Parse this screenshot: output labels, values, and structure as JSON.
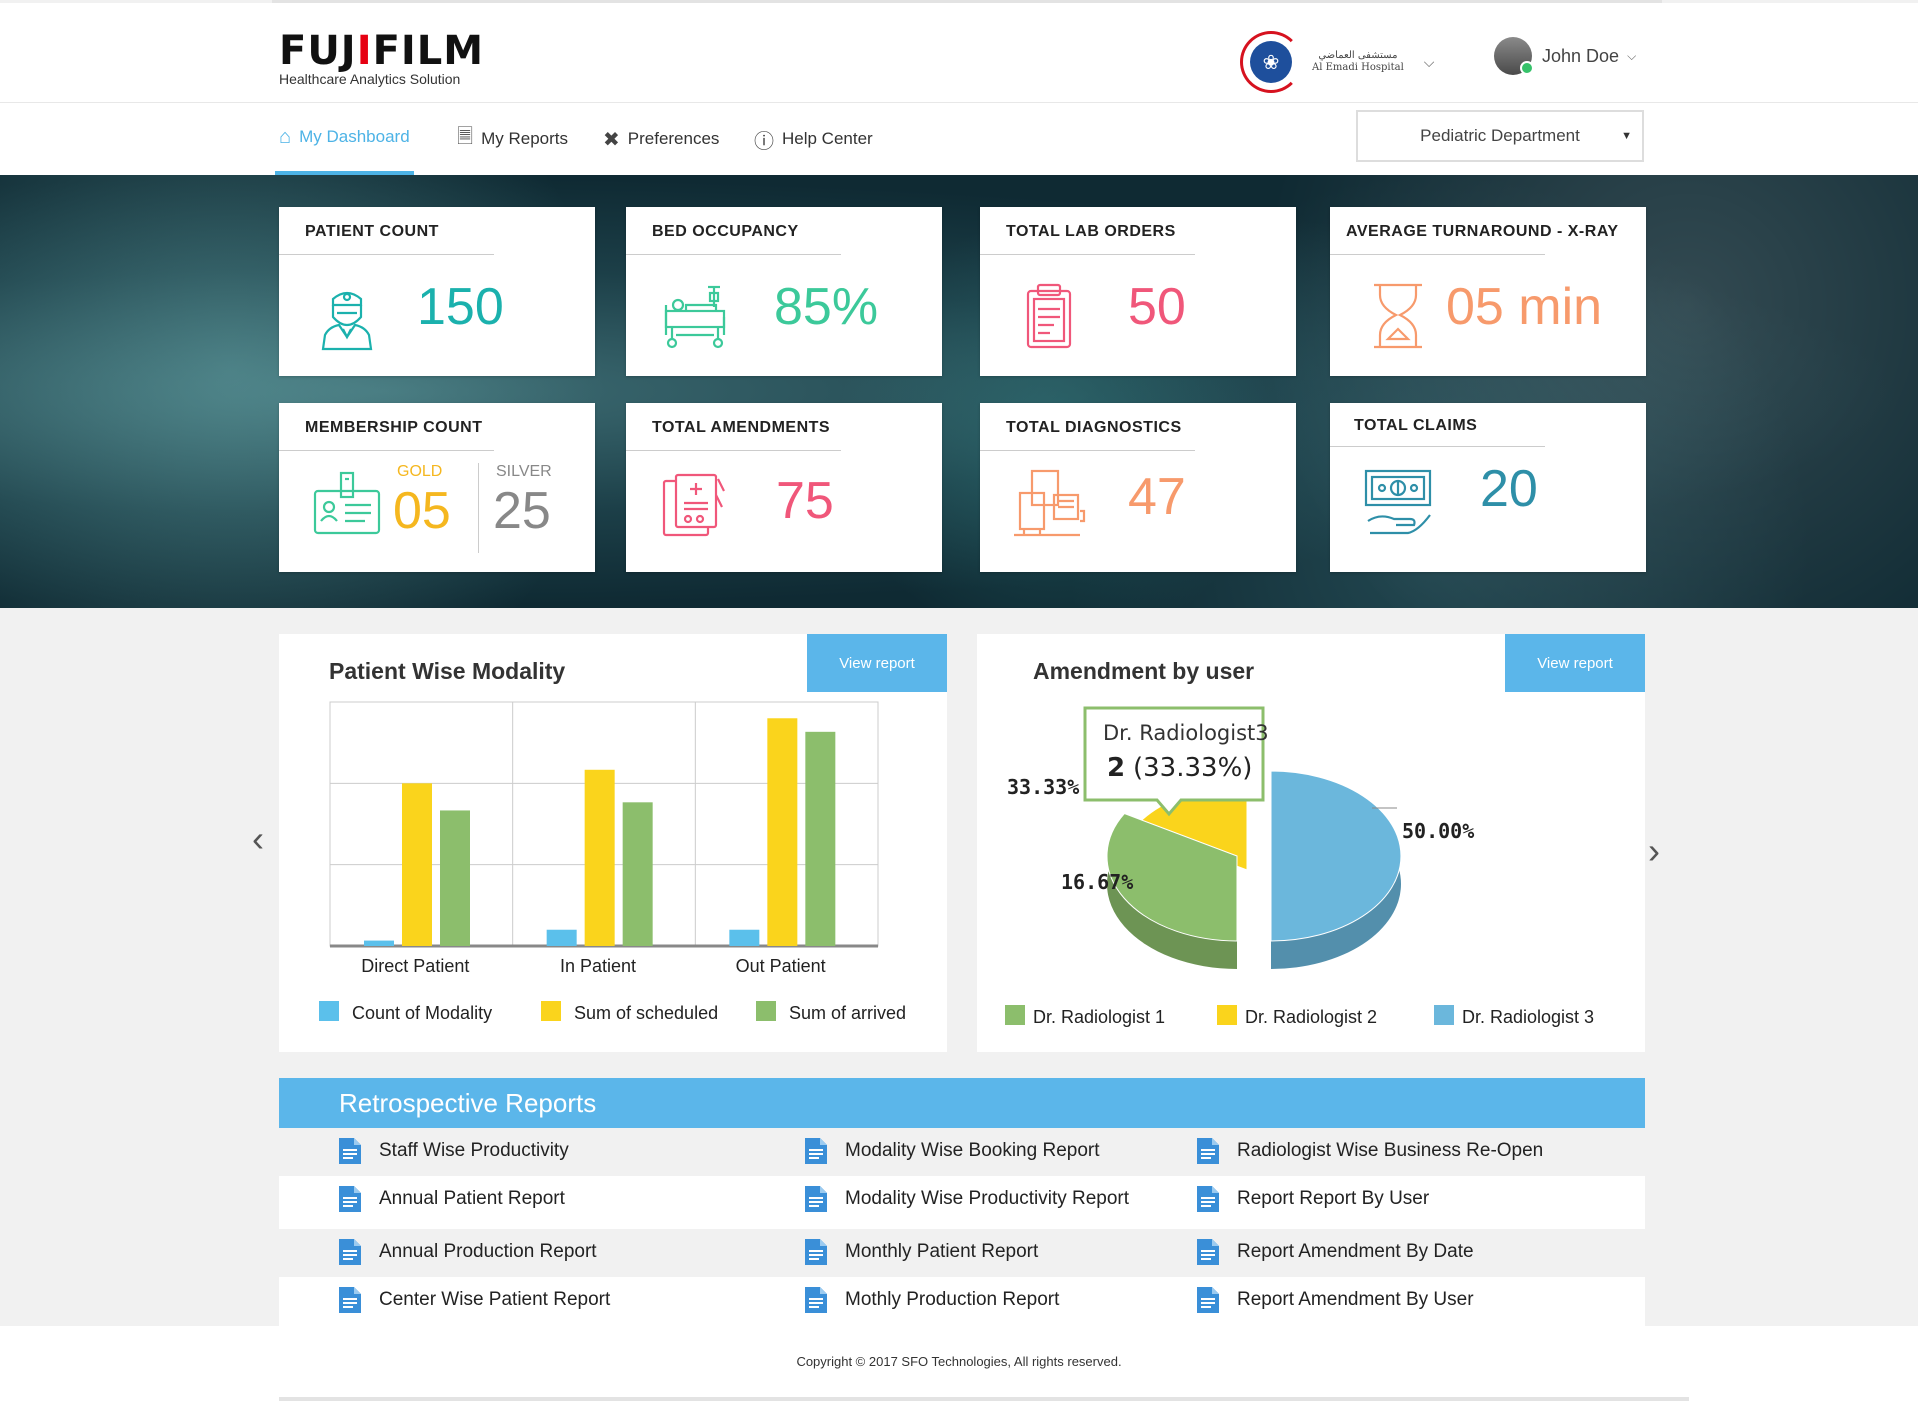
{
  "brand": {
    "name_part1": "FUJ",
    "name_i": "I",
    "name_part2": "FILM",
    "tagline": "Healthcare Analytics Solution"
  },
  "hospital": {
    "name_arabic": "مستشفى العماضي",
    "name_english": "Al Emadi Hospital"
  },
  "user": {
    "name": "John Doe"
  },
  "nav": {
    "items": [
      {
        "label": "My Dashboard",
        "icon": "home-icon",
        "active": true
      },
      {
        "label": "My Reports",
        "icon": "reports-icon",
        "active": false
      },
      {
        "label": "Preferences",
        "icon": "tools-icon",
        "active": false
      },
      {
        "label": "Help Center",
        "icon": "info-icon",
        "active": false
      }
    ],
    "department": "Pediatric Department"
  },
  "stats": {
    "patient_count": {
      "title": "PATIENT COUNT",
      "value": "150",
      "color": "#1bb1ad",
      "icon": "doctor-icon"
    },
    "bed_occupancy": {
      "title": "BED OCCUPANCY",
      "value": "85%",
      "color": "#3cc99a",
      "icon": "hospital-bed-icon"
    },
    "lab_orders": {
      "title": "TOTAL LAB ORDERS",
      "value": "50",
      "color": "#f0577a",
      "icon": "clipboard-icon"
    },
    "turnaround": {
      "title": "AVERAGE TURNAROUND - X-RAY",
      "value": "05 min",
      "color": "#f79a6c",
      "icon": "hourglass-icon"
    },
    "membership": {
      "title": "MEMBERSHIP COUNT",
      "gold_label": "GOLD",
      "gold_value": "05",
      "silver_label": "SILVER",
      "silver_value": "25",
      "gold_color": "#f5b71f",
      "silver_color": "#888888",
      "icon": "id-card-icon"
    },
    "amendments": {
      "title": "TOTAL AMENDMENTS",
      "value": "75",
      "color": "#f0577a",
      "icon": "prescription-icon"
    },
    "diagnostics": {
      "title": "TOTAL DIAGNOSTICS",
      "value": "47",
      "color": "#f79a6c",
      "icon": "diagnostic-machine-icon"
    },
    "claims": {
      "title": "TOTAL CLAIMS",
      "value": "20",
      "color": "#2e8fa8",
      "icon": "money-hand-icon"
    }
  },
  "panels": {
    "modality": {
      "title": "Patient Wise Modality",
      "button": "View report"
    },
    "amendment": {
      "title": "Amendment by user",
      "button": "View report"
    }
  },
  "chart_data": [
    {
      "type": "bar",
      "title": "Patient Wise Modality",
      "categories": [
        "Direct Patient",
        "In Patient",
        "Out Patient"
      ],
      "series": [
        {
          "name": "Count of Modality",
          "color": "#5bc0eb",
          "values": [
            0.2,
            0.6,
            0.6
          ]
        },
        {
          "name": "Sum of scheduled",
          "color": "#fad41c",
          "values": [
            6,
            6.5,
            8.4
          ]
        },
        {
          "name": "Sum of arrived",
          "color": "#8cbe6c",
          "values": [
            5,
            5.3,
            7.9
          ]
        }
      ],
      "ylim": [
        0,
        9
      ],
      "grid": true,
      "legend": "bottom"
    },
    {
      "type": "pie",
      "title": "Amendment by user",
      "slices": [
        {
          "name": "Dr. Radiologist 1",
          "value": 33.33,
          "label": "33.33%",
          "color": "#8cbe6c"
        },
        {
          "name": "Dr. Radiologist 2",
          "value": 16.67,
          "label": "16.67%",
          "color": "#fad41c"
        },
        {
          "name": "Dr. Radiologist 3",
          "value": 50.0,
          "label": "50.00%",
          "color": "#6bb7dc"
        }
      ],
      "tooltip": {
        "name": "Dr. Radiologist3",
        "count": "2",
        "pct": "(33.33%)"
      },
      "legend": "bottom"
    }
  ],
  "reports": {
    "title": "Retrospective Reports",
    "rows": [
      [
        "Staff Wise Productivity",
        "Modality Wise Booking Report",
        "Radiologist Wise Business Re-Open"
      ],
      [
        "Annual Patient Report",
        "Modality Wise Productivity Report",
        "Report Report By User"
      ],
      [
        "Annual Production Report",
        "Monthly Patient Report",
        "Report Amendment By Date"
      ],
      [
        "Center Wise Patient Report",
        "Mothly Production Report",
        "Report Amendment By User"
      ]
    ]
  },
  "footer": {
    "copyright": "Copyright © 2017 SFO Technologies, All rights reserved."
  }
}
